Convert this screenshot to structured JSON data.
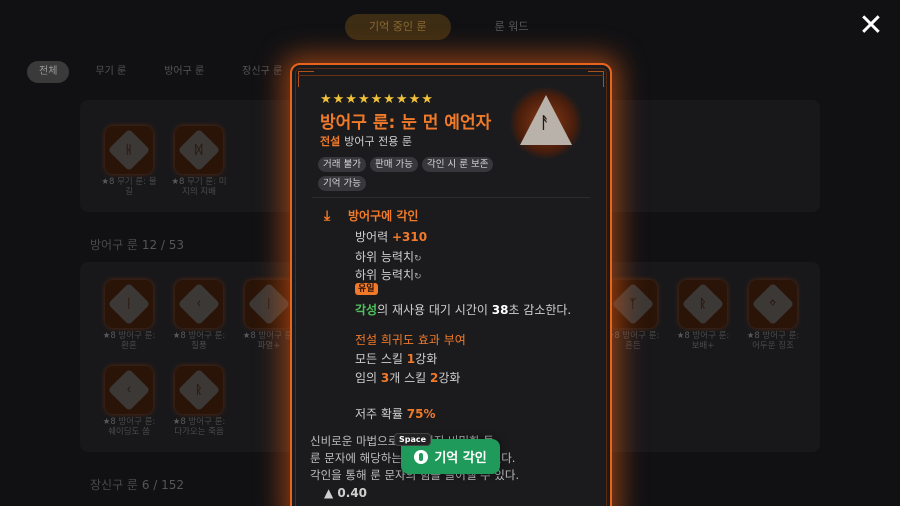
{
  "top_tabs": [
    {
      "label": "기억 중인 룬",
      "active": true
    },
    {
      "label": "룬 워드",
      "active": false
    }
  ],
  "filters": [
    {
      "label": "전체",
      "active": true
    },
    {
      "label": "무기 룬",
      "active": false
    },
    {
      "label": "방어구 룬",
      "active": false
    },
    {
      "label": "장신구 룬",
      "active": false
    }
  ],
  "sections": {
    "armor": {
      "name": "방어구 룬",
      "count": "12 / 53"
    },
    "accessory": {
      "name": "장신구 룬",
      "count": "6 / 152"
    }
  },
  "weapon_runes": [
    {
      "level": "★8",
      "name": "무기 룬: 불길",
      "glyph": "ᚺ"
    },
    {
      "level": "★8",
      "name": "무기 룬: 미지의 지배",
      "glyph": "ᛞ"
    }
  ],
  "armor_runes": [
    {
      "level": "★8",
      "name": "방어구 룬: 환혼",
      "glyph": "ᛁ"
    },
    {
      "level": "★8",
      "name": "방어구 룬: 질풍",
      "glyph": "ᚲ"
    },
    {
      "level": "★8",
      "name": "방어구 룬: 파멸+",
      "glyph": "ᛁ"
    },
    {
      "level": "★8",
      "name": "방어구 룬: 흔든",
      "glyph": "ᛉ"
    },
    {
      "level": "★8",
      "name": "방어구 룬: 보배+",
      "glyph": "ᚱ"
    },
    {
      "level": "★8",
      "name": "방어구 룬: 어두운 징조",
      "glyph": "ᛜ"
    },
    {
      "level": "★8",
      "name": "방어구 룬: 쉐이딩도 쏨",
      "glyph": "ᚲ"
    },
    {
      "level": "★8",
      "name": "방어구 룬: 다가오는 죽음",
      "glyph": "ᚱ"
    }
  ],
  "tooltip": {
    "stars": "★★★★★★★★★",
    "title": "방어구 룬: 눈 먼 예언자",
    "grade": "전설",
    "type": "방어구 전용 룬",
    "rune_glyph": "ᚨ",
    "tags": [
      "거래 불가",
      "판매 가능",
      "각인 시 룬 보존",
      "기억 가능"
    ],
    "engrave_title": "방어구에 각인",
    "defense_label": "방어력",
    "defense_value": "+310",
    "sub_stat_1": "하위 능력치",
    "sub_stat_2": "하위 능력치",
    "reroll_icon": "↻",
    "unique_badge": "유일",
    "awaken_word": "각성",
    "effect_1_a": "의 재사용 대기 시간이 ",
    "effect_1_num": "38",
    "effect_1_b": "초 감소한다.",
    "legend_head": "전설 희귀도 효과 부여",
    "legend_1_a": "모든 스킬 ",
    "legend_1_num": "1",
    "legend_1_b": "강화",
    "legend_2_a": "임의 ",
    "legend_2_num1": "3",
    "legend_2_mid": "개 스킬 ",
    "legend_2_num2": "2",
    "legend_2_b": "강화",
    "curse_label": "저주 확률 ",
    "curse_value": "75%",
    "description_1": "신비로운 마법으로 만들어진 비밀한 돌.",
    "description_2": "룬 문자에 해당하는 고대의 힘이 담겨 있다.",
    "description_3": "각인을 통해 룬 문자의 힘을 끌어낼 수 있다.",
    "price": "0.40"
  },
  "action": {
    "key": "Space",
    "label": "기억 각인"
  },
  "close_icon": "close-icon",
  "colors": {
    "accent": "#f07a2a",
    "button": "#1f9a5a"
  }
}
